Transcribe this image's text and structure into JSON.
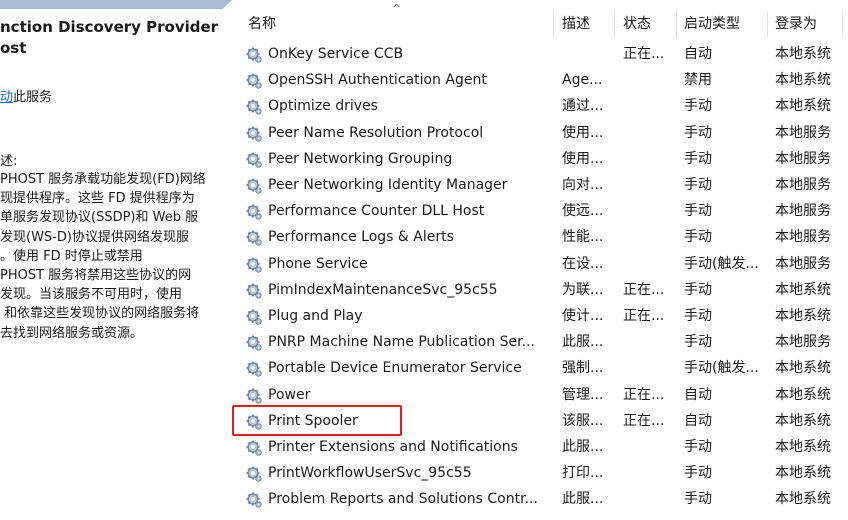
{
  "left_panel": {
    "title_line1": "nction Discovery Provider",
    "title_line2": "ost",
    "action_link": "动",
    "action_text": "此服务",
    "description_label": "述:",
    "description_lines": [
      "PHOST 服务承载功能发现(FD)网络",
      "现提供程序。这些 FD 提供程序为",
      "单服务发现协议(SSDP)和 Web 服",
      "发现(WS-D)协议提供网络发现服",
      "。使用 FD 时停止或禁用",
      "PHOST 服务将禁用这些协议的网",
      "发现。当该服务不可用时，使用",
      " 和依靠这些发现协议的网络服务将",
      "去找到网络服务或资源。"
    ]
  },
  "table": {
    "columns": [
      "名称",
      "描述",
      "状态",
      "启动类型",
      "登录为"
    ],
    "sort_indicator": "^",
    "highlight_color": "#e02020",
    "rows": [
      {
        "name": "OnKey Service CCB",
        "desc": "",
        "status": "正在...",
        "start": "自动",
        "logon": "本地系统"
      },
      {
        "name": "OpenSSH Authentication Agent",
        "desc": "Age...",
        "status": "",
        "start": "禁用",
        "logon": "本地系统"
      },
      {
        "name": "Optimize drives",
        "desc": "通过...",
        "status": "",
        "start": "手动",
        "logon": "本地系统"
      },
      {
        "name": "Peer Name Resolution Protocol",
        "desc": "使用...",
        "status": "",
        "start": "手动",
        "logon": "本地服务"
      },
      {
        "name": "Peer Networking Grouping",
        "desc": "使用...",
        "status": "",
        "start": "手动",
        "logon": "本地服务"
      },
      {
        "name": "Peer Networking Identity Manager",
        "desc": "向对...",
        "status": "",
        "start": "手动",
        "logon": "本地服务"
      },
      {
        "name": "Performance Counter DLL Host",
        "desc": "使远...",
        "status": "",
        "start": "手动",
        "logon": "本地服务"
      },
      {
        "name": "Performance Logs & Alerts",
        "desc": "性能...",
        "status": "",
        "start": "手动",
        "logon": "本地服务"
      },
      {
        "name": "Phone Service",
        "desc": "在设...",
        "status": "",
        "start": "手动(触发...",
        "logon": "本地服务"
      },
      {
        "name": "PimIndexMaintenanceSvc_95c55",
        "desc": "为联...",
        "status": "正在...",
        "start": "手动",
        "logon": "本地系统"
      },
      {
        "name": "Plug and Play",
        "desc": "使计...",
        "status": "正在...",
        "start": "手动",
        "logon": "本地系统"
      },
      {
        "name": "PNRP Machine Name Publication Ser...",
        "desc": "此服...",
        "status": "",
        "start": "手动",
        "logon": "本地服务"
      },
      {
        "name": "Portable Device Enumerator Service",
        "desc": "强制...",
        "status": "",
        "start": "手动(触发...",
        "logon": "本地系统"
      },
      {
        "name": "Power",
        "desc": "管理...",
        "status": "正在...",
        "start": "自动",
        "logon": "本地系统"
      },
      {
        "name": "Print Spooler",
        "desc": "该服...",
        "status": "正在...",
        "start": "自动",
        "logon": "本地系统"
      },
      {
        "name": "Printer Extensions and Notifications",
        "desc": "此服...",
        "status": "",
        "start": "手动",
        "logon": "本地系统"
      },
      {
        "name": "PrintWorkflowUserSvc_95c55",
        "desc": "打印...",
        "status": "",
        "start": "手动",
        "logon": "本地系统"
      },
      {
        "name": "Problem Reports and Solutions Contr...",
        "desc": "此服...",
        "status": "",
        "start": "手动",
        "logon": "本地系统"
      }
    ]
  }
}
